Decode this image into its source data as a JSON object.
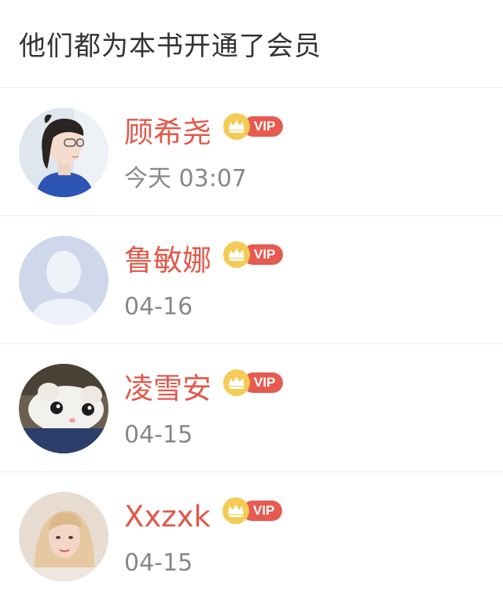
{
  "header": {
    "title": "他们都为本书开通了会员"
  },
  "members": [
    {
      "name": "顾希尧",
      "time": "今天 03:07",
      "badge": "VIP",
      "avatar": "girl-photo-avatar"
    },
    {
      "name": "鲁敏娜",
      "time": "04-16",
      "badge": "VIP",
      "avatar": "default-avatar"
    },
    {
      "name": "凌雪安",
      "time": "04-15",
      "badge": "VIP",
      "avatar": "cat-photo-avatar"
    },
    {
      "name": "Xxzxk",
      "time": "04-15",
      "badge": "VIP",
      "avatar": "woman-photo-avatar"
    }
  ],
  "colors": {
    "name": "#e2584a",
    "vip": "#e65a50",
    "crown": "#f2c24a",
    "time": "#888888"
  }
}
